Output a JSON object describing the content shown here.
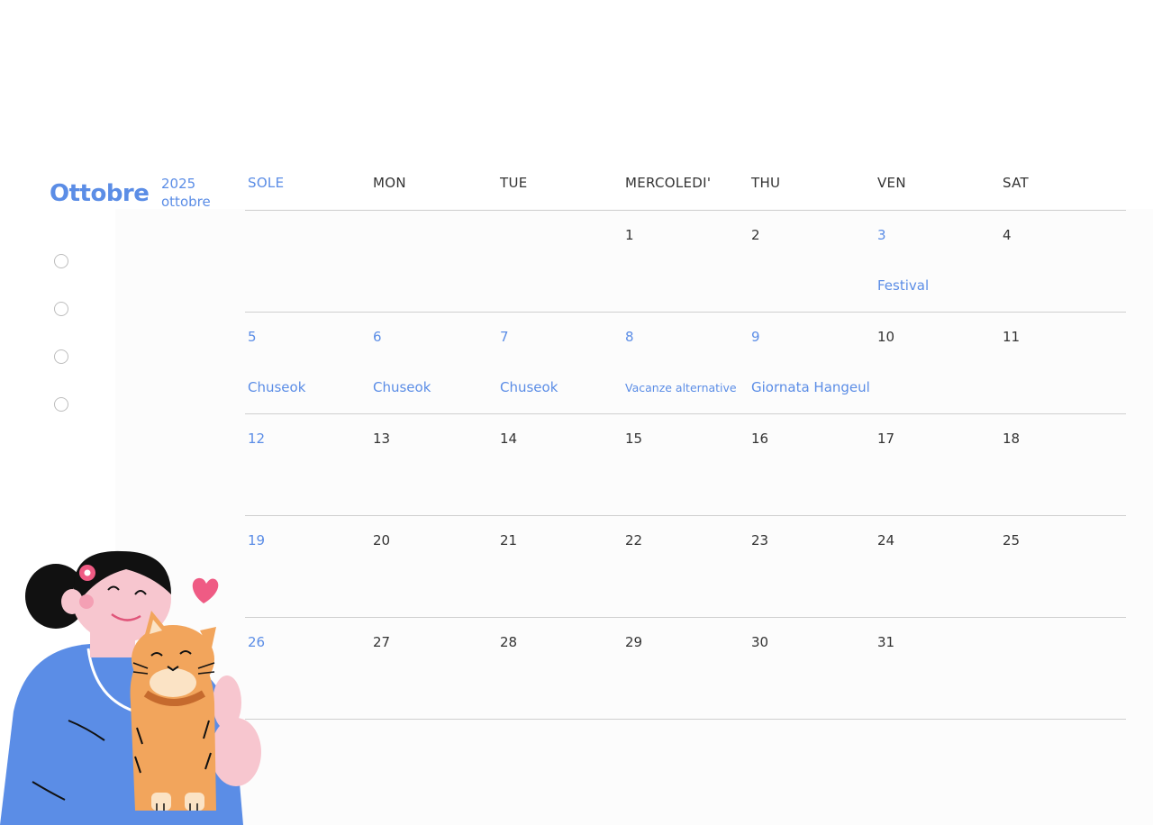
{
  "colors": {
    "accent": "#5b8de6",
    "text": "#333333",
    "grid_line": "#cfcfcf"
  },
  "header": {
    "month": "Ottobre",
    "year": "2025",
    "month_small": "ottobre"
  },
  "checklist": [
    {
      "checked": false
    },
    {
      "checked": false
    },
    {
      "checked": false
    },
    {
      "checked": false
    }
  ],
  "weekdays": [
    {
      "label": "SOLE",
      "accent": true
    },
    {
      "label": "MON",
      "accent": false
    },
    {
      "label": "TUE",
      "accent": false
    },
    {
      "label": "MERCOLEDI'",
      "accent": false
    },
    {
      "label": "THU",
      "accent": false
    },
    {
      "label": "VEN",
      "accent": false
    },
    {
      "label": "SAT",
      "accent": false
    }
  ],
  "weeks": [
    [
      {
        "day": "",
        "event": "",
        "accent": false
      },
      {
        "day": "",
        "event": "",
        "accent": false
      },
      {
        "day": "",
        "event": "",
        "accent": false
      },
      {
        "day": "1",
        "event": "",
        "accent": false
      },
      {
        "day": "2",
        "event": "",
        "accent": false
      },
      {
        "day": "3",
        "event": "Festival",
        "accent": true
      },
      {
        "day": "4",
        "event": "",
        "accent": false
      }
    ],
    [
      {
        "day": "5",
        "event": "Chuseok",
        "accent": true
      },
      {
        "day": "6",
        "event": "Chuseok",
        "accent": true
      },
      {
        "day": "7",
        "event": "Chuseok",
        "accent": true
      },
      {
        "day": "8",
        "event": "Vacanze alternative",
        "accent": true,
        "small": true
      },
      {
        "day": "9",
        "event": "Giornata Hangeul",
        "accent": true
      },
      {
        "day": "10",
        "event": "",
        "accent": false
      },
      {
        "day": "11",
        "event": "",
        "accent": false
      }
    ],
    [
      {
        "day": "12",
        "event": "",
        "accent": true
      },
      {
        "day": "13",
        "event": "",
        "accent": false
      },
      {
        "day": "14",
        "event": "",
        "accent": false
      },
      {
        "day": "15",
        "event": "",
        "accent": false
      },
      {
        "day": "16",
        "event": "",
        "accent": false
      },
      {
        "day": "17",
        "event": "",
        "accent": false
      },
      {
        "day": "18",
        "event": "",
        "accent": false
      }
    ],
    [
      {
        "day": "19",
        "event": "",
        "accent": true
      },
      {
        "day": "20",
        "event": "",
        "accent": false
      },
      {
        "day": "21",
        "event": "",
        "accent": false
      },
      {
        "day": "22",
        "event": "",
        "accent": false
      },
      {
        "day": "23",
        "event": "",
        "accent": false
      },
      {
        "day": "24",
        "event": "",
        "accent": false
      },
      {
        "day": "25",
        "event": "",
        "accent": false
      }
    ],
    [
      {
        "day": "26",
        "event": "",
        "accent": true
      },
      {
        "day": "27",
        "event": "",
        "accent": false
      },
      {
        "day": "28",
        "event": "",
        "accent": false
      },
      {
        "day": "29",
        "event": "",
        "accent": false
      },
      {
        "day": "30",
        "event": "",
        "accent": false
      },
      {
        "day": "31",
        "event": "",
        "accent": false
      },
      {
        "day": "",
        "event": "",
        "accent": false
      }
    ]
  ],
  "illustration": {
    "icon": "girl-hugging-cat-illustration"
  }
}
